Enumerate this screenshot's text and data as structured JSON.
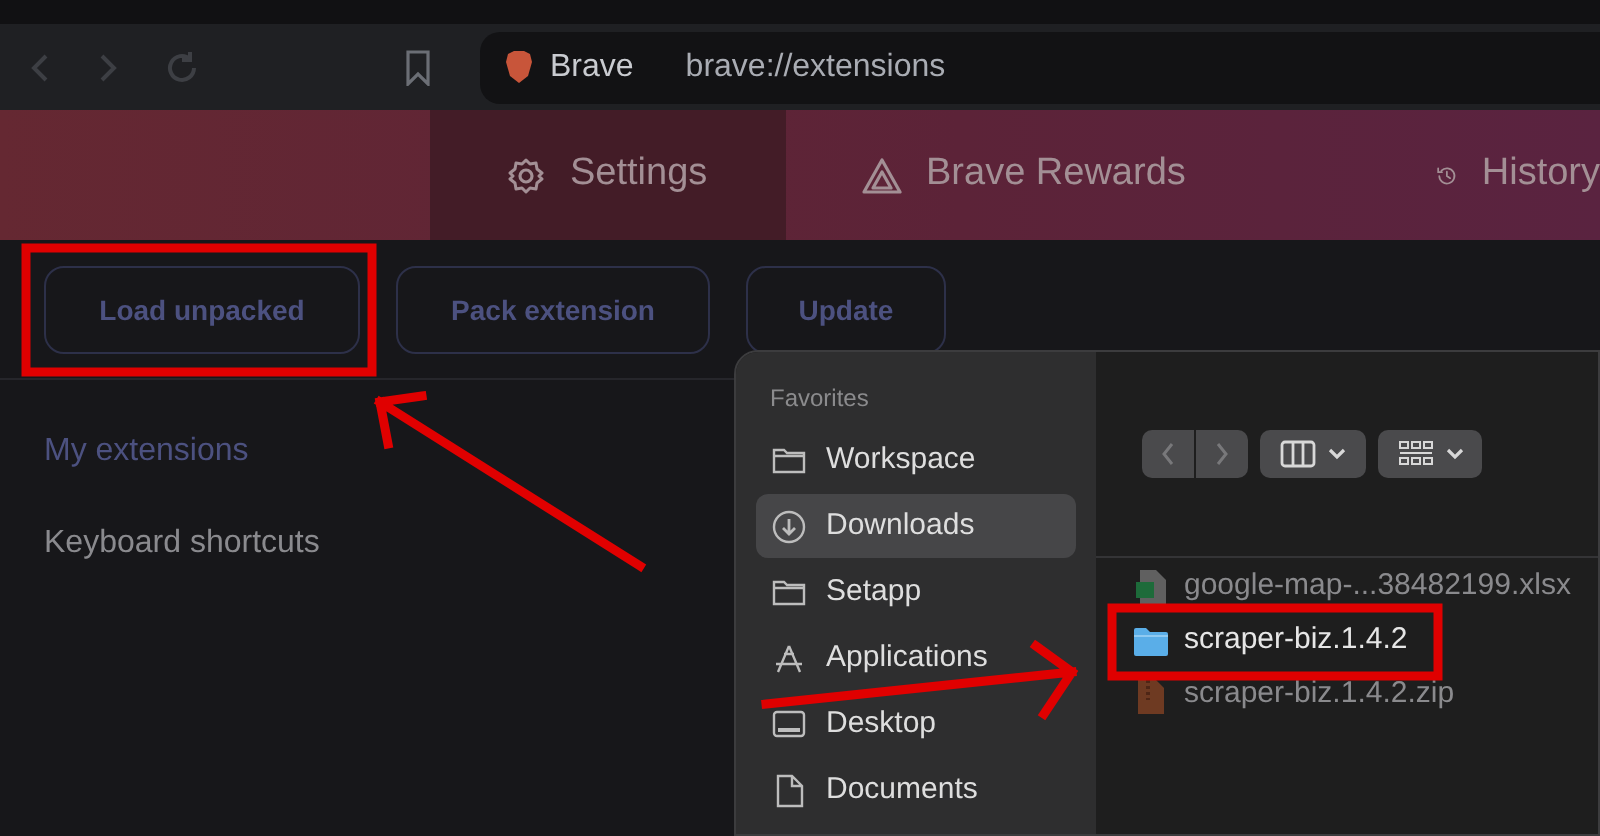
{
  "browser": {
    "brand": "Brave",
    "url": "brave://extensions"
  },
  "header_tabs": [
    {
      "label": "Settings",
      "kind": "gear",
      "selected": true
    },
    {
      "label": "Brave Rewards",
      "kind": "triangle",
      "selected": false
    },
    {
      "label": "History",
      "kind": "history",
      "selected": false
    }
  ],
  "actions": [
    "Load unpacked",
    "Pack extension",
    "Update"
  ],
  "nav": [
    {
      "label": "My extensions",
      "selected": true
    },
    {
      "label": "Keyboard shortcuts",
      "selected": false
    }
  ],
  "file_dialog": {
    "sidebar_heading": "Favorites",
    "sidebar": [
      {
        "label": "Workspace",
        "kind": "folder",
        "selected": false
      },
      {
        "label": "Downloads",
        "kind": "download",
        "selected": true
      },
      {
        "label": "Setapp",
        "kind": "folder",
        "selected": false
      },
      {
        "label": "Applications",
        "kind": "apps",
        "selected": false
      },
      {
        "label": "Desktop",
        "kind": "desktop",
        "selected": false
      },
      {
        "label": "Documents",
        "kind": "document",
        "selected": false
      }
    ],
    "files": [
      {
        "name": "google-map-...38482199.xlsx",
        "kind": "spreadsheet",
        "disabled": true
      },
      {
        "name": "scraper-biz.1.4.2",
        "kind": "folder",
        "disabled": false
      },
      {
        "name": "scraper-biz.1.4.2.zip",
        "kind": "archive",
        "disabled": true
      }
    ]
  }
}
